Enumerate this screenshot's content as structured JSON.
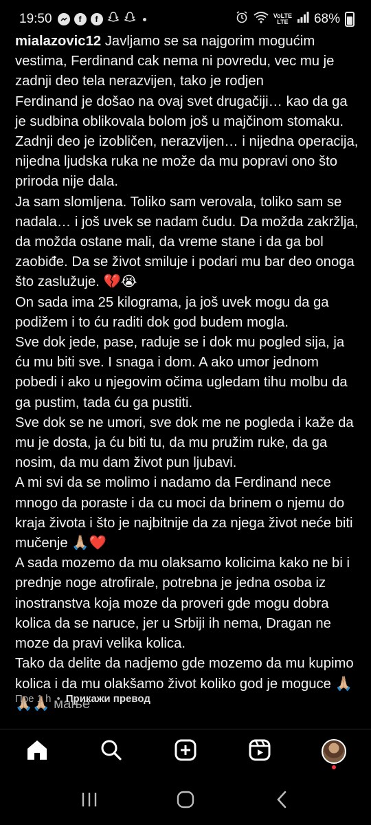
{
  "status_bar": {
    "time": "19:50",
    "battery": "68%",
    "network_label_top": "VoLTE",
    "network_label_bottom": "LTE",
    "notification_icons": [
      "messenger-icon",
      "facebook-icon",
      "facebook-icon",
      "snapchat-icon",
      "snapchat-icon"
    ]
  },
  "post": {
    "username": "mialazovic12",
    "caption": " Javljamo se sa najgorim mogućim vestima, Ferdinand cak nema ni povredu, vec mu je zadnji deo tela nerazvijen, tako je rodjen\nFerdinand je došao na ovaj svet drugačiji… kao da ga je sudbina oblikovala bolom još u majčinom stomaku. Zadnji deo je izobličen, nerazvijen… i nijedna operacija, nijedna ljudska ruka ne može da mu popravi ono što priroda nije dala.\nJa sam slomljena. Toliko sam verovala, toliko sam se nadala… i još uvek se nadam čudu. Da možda zakržlja, da možda ostane mali, da vreme stane i da ga bol zaobiđe. Da se život smiluje i podari mu bar deo onoga što zaslužuje. 💔😭\nOn sada ima 25 kilograma, ja još uvek mogu da ga podižem i to ću raditi dok god budem mogla.\nSve dok jede, pase, raduje se i dok mu pogled sija, ja ću mu biti sve. I snaga i dom. A ako umor jednom pobedi i ako u njegovim očima ugledam tihu molbu da ga pustim, tada ću ga pustiti.\nSve dok se ne umori, sve dok me ne pogleda i kaže da mu je dosta, ja ću biti tu, da mu pružim ruke, da ga nosim, da mu dam život pun ljubavi.\nA mi svi da se molimo i nadamo da Ferdinand nece mnogo da poraste i da cu moci da brinem o njemu do kraja života i što je najbitnije da za njega život neće biti mučenje 🙏🏼❤️\nA sada mozemo da mu olaksamo kolicima kako ne bi i prednje noge atrofirale, potrebna je jedna osoba iz inostranstva koja moze da proveri gde mogu dobra kolica da se naruce, jer u Srbiji ih nema, Dragan ne moze da pravi velika kolica.\nTako da delite da nadjemo gde mozemo da mu kupimo kolica i da mu olakšamo život koliko god je moguce 🙏🏼🙏🏼🙏🏼 ",
    "less_label": "мање",
    "time_ago": "Пре 1 h",
    "separator": "•",
    "translate_label": "Прикажи превод"
  },
  "bottom_nav": {
    "items": [
      "home-icon",
      "search-icon",
      "create-icon",
      "reels-icon",
      "profile-avatar"
    ]
  },
  "system_nav": {
    "items": [
      "recent-apps-icon",
      "home-button-icon",
      "back-icon"
    ]
  }
}
